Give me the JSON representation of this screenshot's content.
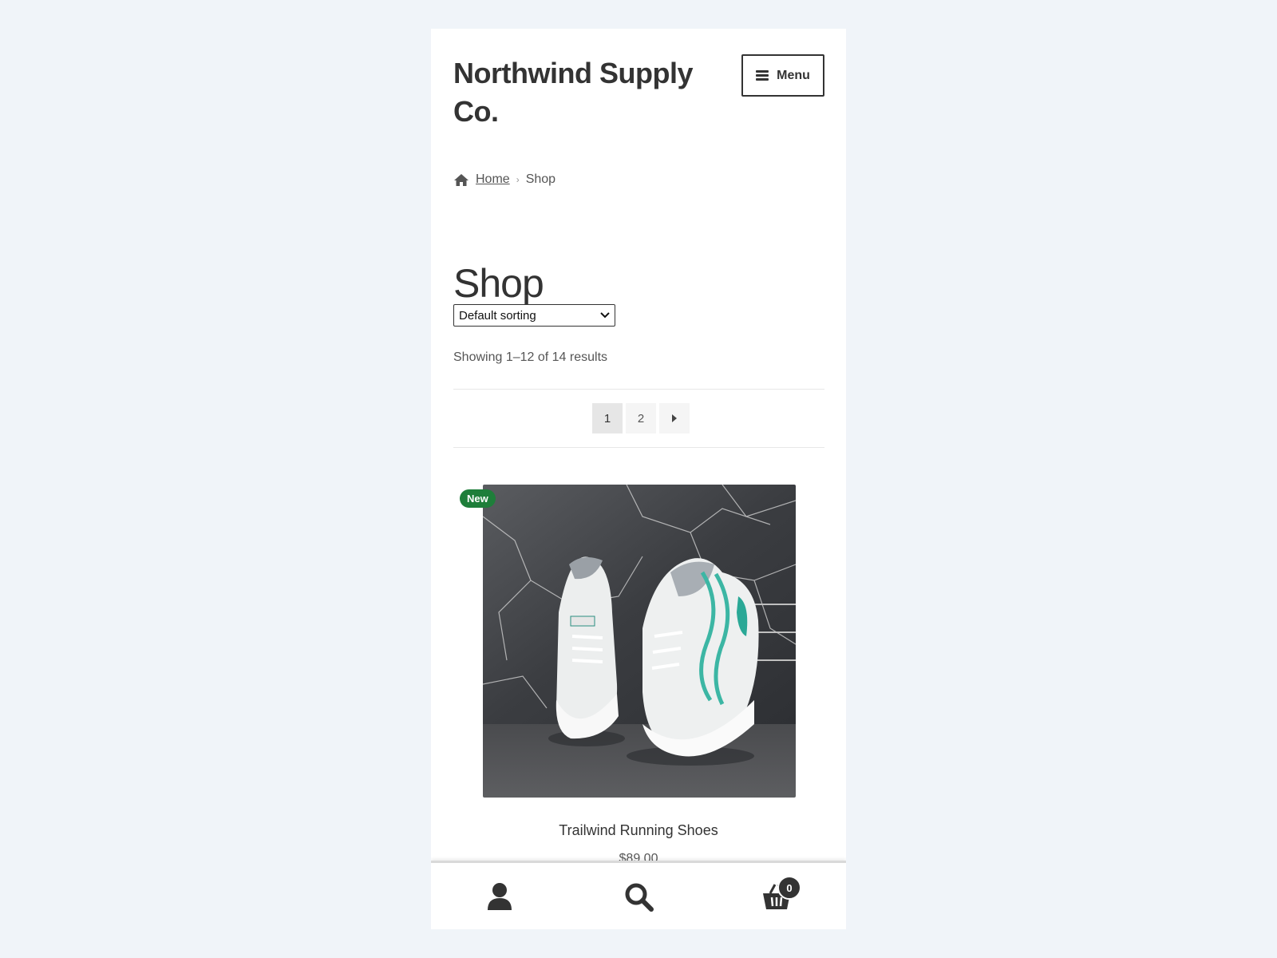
{
  "site": {
    "title": "Northwind Supply Co."
  },
  "header": {
    "menu_label": "Menu"
  },
  "breadcrumb": {
    "home": "Home",
    "current": "Shop"
  },
  "page": {
    "title": "Shop"
  },
  "sorting": {
    "selected": "Default sorting"
  },
  "results": {
    "count_text": "Showing 1–12 of 14 results"
  },
  "pagination": {
    "pages": [
      "1",
      "2"
    ],
    "current": "1"
  },
  "products": [
    {
      "badge": "New",
      "title": "Trailwind Running Shoes",
      "price": "$89.00"
    }
  ],
  "footer_bar": {
    "cart_count": "0"
  },
  "colors": {
    "badge": "#1e7e3a",
    "text": "#333333",
    "background": "#f0f4f9"
  }
}
